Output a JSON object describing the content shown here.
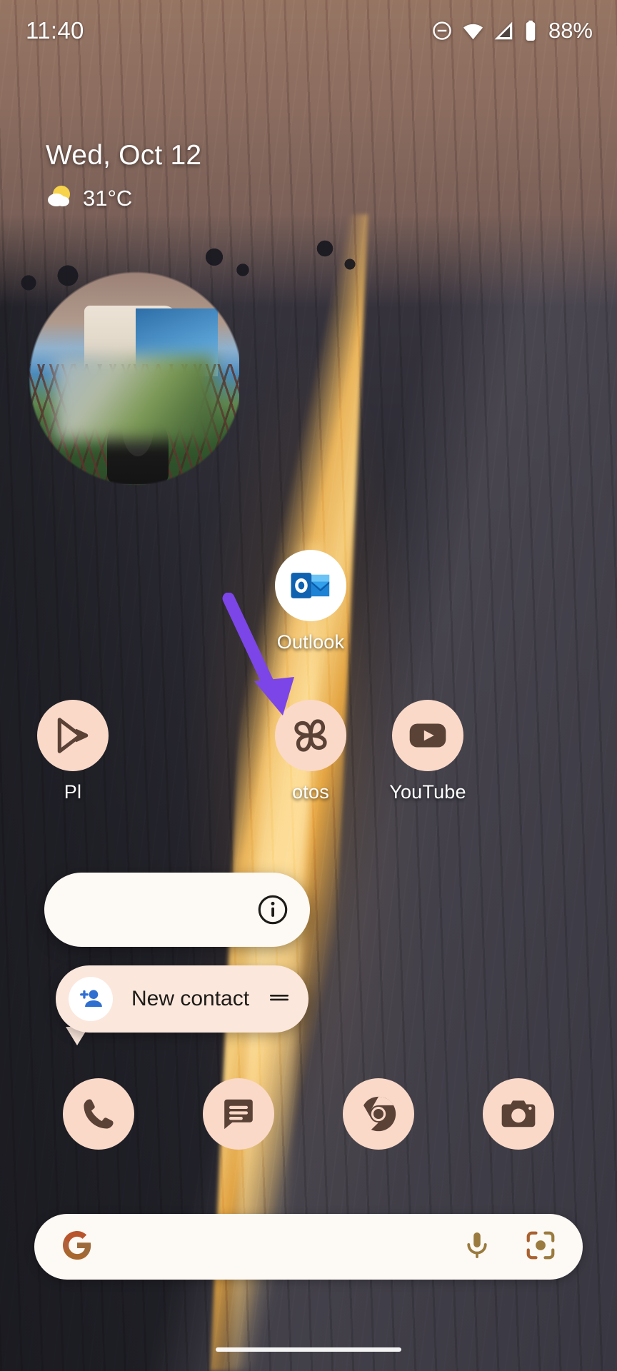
{
  "status_bar": {
    "time": "11:40",
    "battery_percent": "88%",
    "icons": [
      "do-not-disturb-icon",
      "wifi-icon",
      "signal-icon",
      "battery-icon"
    ]
  },
  "at_a_glance": {
    "date": "Wed, Oct 12",
    "temperature": "31°C",
    "weather_icon": "partly-cloudy-icon"
  },
  "widgets": {
    "photo_widget_name": "photo-widget"
  },
  "apps": [
    {
      "id": "outlook",
      "label": "Outlook",
      "icon": "outlook-icon",
      "circle_color": "#ffffff"
    },
    {
      "id": "playstore",
      "label": "Pl",
      "icon": "play-store-icon",
      "circle_color": "#fad9c8"
    },
    {
      "id": "photos",
      "label": "otos",
      "icon": "photos-icon",
      "circle_color": "#fad9c8"
    },
    {
      "id": "youtube",
      "label": "YouTube",
      "icon": "youtube-icon",
      "circle_color": "#fad9c8"
    }
  ],
  "dock": [
    {
      "id": "phone",
      "icon": "phone-icon"
    },
    {
      "id": "messages",
      "icon": "messages-icon"
    },
    {
      "id": "chrome",
      "icon": "chrome-icon"
    },
    {
      "id": "camera",
      "icon": "camera-icon"
    }
  ],
  "popup": {
    "info_icon": "info-icon",
    "shortcut_label": "New contact",
    "shortcut_icon": "person-add-icon",
    "drag_handle_icon": "drag-handle-icon"
  },
  "search_bar": {
    "logo_icon": "google-g-icon",
    "mic_icon": "microphone-icon",
    "lens_icon": "google-lens-icon",
    "query": ""
  },
  "navigation": {
    "gesture_pill": "home-gesture-pill"
  },
  "annotation": {
    "arrow_icon": "pointer-arrow-icon",
    "arrow_color": "#7C45E8"
  },
  "colors": {
    "themed_icon_bg": "#fad9c8",
    "themed_icon_fg": "#5a4236",
    "popup_bg": "#fdf9f4",
    "shortcut_bg": "#fbe7dc",
    "accent_purple": "#7C45E8"
  }
}
